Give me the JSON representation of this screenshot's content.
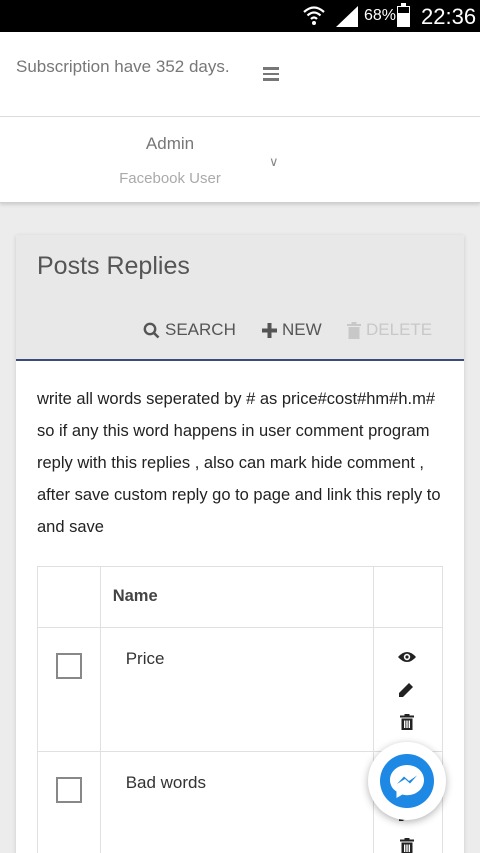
{
  "status_bar": {
    "battery_percent": "68%",
    "battery_level": 0.68,
    "time": "22:36",
    "icons": [
      "wifi-icon",
      "signal-icon",
      "battery-icon"
    ]
  },
  "header": {
    "subscription_text": "Subscription have 352 days.",
    "menu_icon": "hamburger-menu-icon"
  },
  "user": {
    "name": "Admin",
    "role": "Facebook User",
    "toggle_icon": "chevron-down-icon"
  },
  "panel": {
    "title": "Posts Replies",
    "toolbar": {
      "search_label": "SEARCH",
      "new_label": "NEW",
      "delete_label": "DELETE"
    },
    "help_text": "write all words seperated by # as price#cost#hm#h.m# so if any this word happens in user comment program reply with this replies , also can mark hide comment , after save custom reply go to page and link this reply to and save"
  },
  "table": {
    "columns": [
      "",
      "Name",
      ""
    ],
    "rows": [
      {
        "name": "Price",
        "checked": false,
        "actions": [
          "eye-icon",
          "pencil-icon",
          "trash-icon"
        ]
      },
      {
        "name": "Bad words",
        "checked": false,
        "actions": [
          "eye-icon",
          "pencil-icon",
          "trash-icon"
        ]
      }
    ]
  },
  "fab": {
    "icon": "messenger-icon"
  },
  "colors": {
    "accent_line": "#3d4b7a",
    "messenger_blue": "#1e88e5",
    "disabled_text": "#c8c8c8"
  }
}
